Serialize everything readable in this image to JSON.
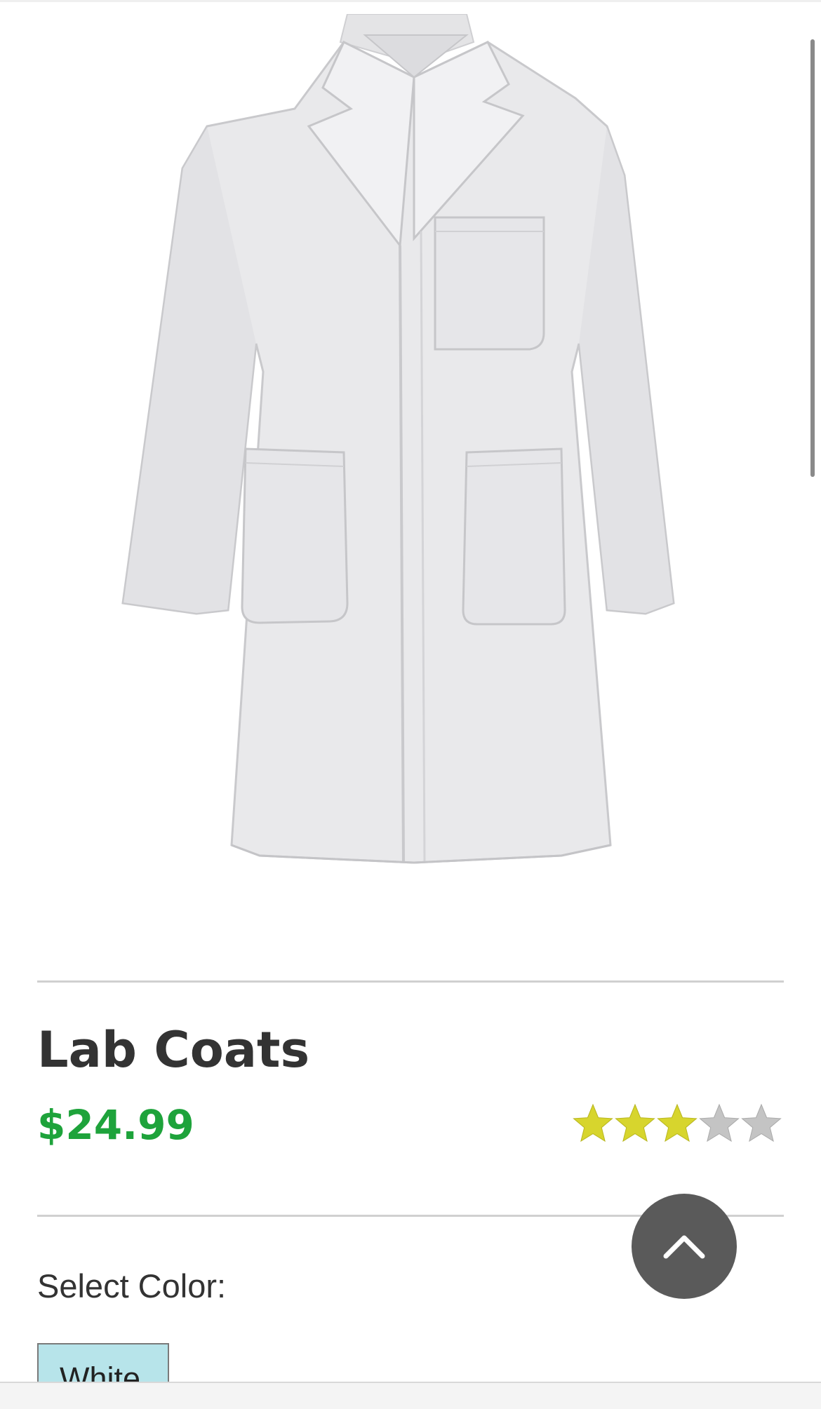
{
  "product": {
    "title": "Lab Coats",
    "price": "$24.99",
    "rating": {
      "value": 3,
      "max": 5
    },
    "image_icon": "lab-coat-image"
  },
  "options": {
    "select_color_label": "Select Color:",
    "colors": [
      "White"
    ]
  },
  "controls": {
    "back_to_top_icon": "chevron-up-icon"
  },
  "colors": {
    "price": "#1ea33b",
    "star_filled": "#d7d52d",
    "star_empty": "#c4c4c4",
    "selected_option_bg": "#b7e4ea",
    "fab_bg": "#5a5a5a"
  }
}
